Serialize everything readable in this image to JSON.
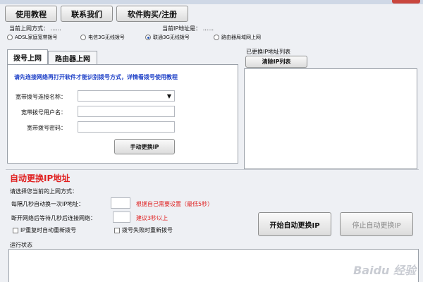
{
  "toolbar": {
    "tutorial": "使用教程",
    "contact": "联系我们",
    "purchase": "软件购买/注册"
  },
  "status": {
    "current_mode_label": "当前上网方式：",
    "current_mode_value": "......",
    "current_ip_label": "当前IP地址是：",
    "current_ip_value": "......"
  },
  "connection_types": [
    {
      "label": "ADSL家庭宽带拨号",
      "selected": false
    },
    {
      "label": "电信3G无线拨号",
      "selected": false
    },
    {
      "label": "联通3G无线拨号",
      "selected": true
    },
    {
      "label": "路由器局域网上网",
      "selected": false
    }
  ],
  "tabs": {
    "dialup": "拨号上网",
    "router": "路由器上网"
  },
  "dialup_panel": {
    "notice": "请先连接网络再打开软件才能识别拨号方式，详情看拨号使用教程",
    "conn_name_label": "宽带拨号连接名称：",
    "username_label": "宽带拨号用户名：",
    "password_label": "宽带拨号密码：",
    "manual_change": "手动更换IP"
  },
  "ip_list": {
    "title": "已更换IP地址列表",
    "clear": "清除IP列表"
  },
  "auto": {
    "title": "自动更换IP地址",
    "mode_prompt": "请选择您当前的上网方式：",
    "interval_label": "每隔几秒自动换一次IP地址：",
    "interval_hint": "根据自己需要设置（最低5秒）",
    "reconnect_label": "断开网络后等待几秒后连接网络：",
    "reconnect_hint": "建议3秒以上",
    "redial_on_dup": "IP重复时自动重新拨号",
    "redial_on_fail": "拨号失败时重新拨号",
    "start": "开始自动更换IP",
    "stop": "停止自动更换IP"
  },
  "log": {
    "title": "运行状态"
  },
  "watermark": "Baidu 经验"
}
